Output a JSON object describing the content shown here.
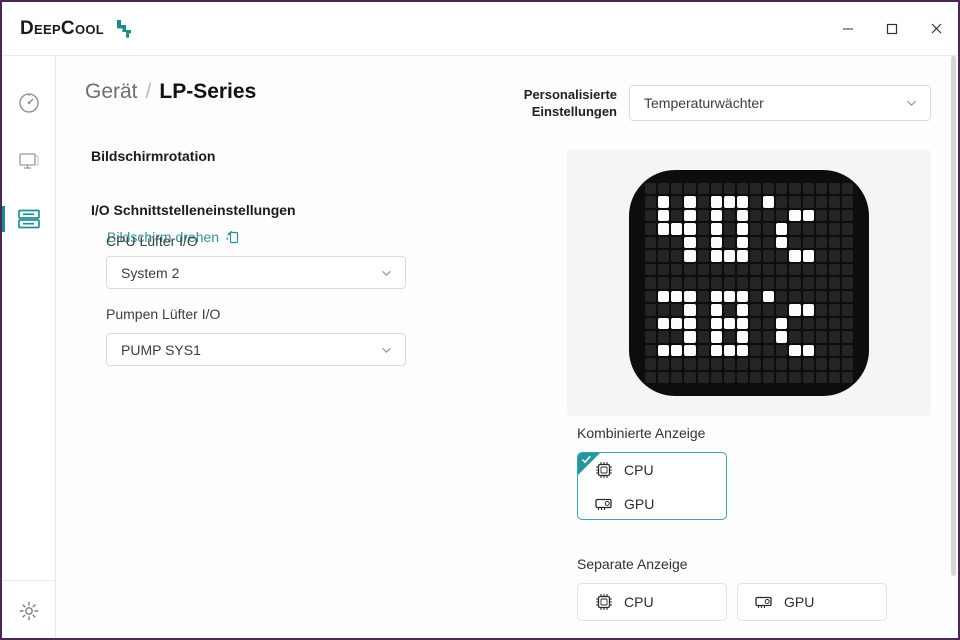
{
  "window": {
    "brand": "DeepCool",
    "brand_mark_icon": "deepcool-logo-icon",
    "controls": {
      "minimize": "minimize-icon",
      "maximize": "maximize-icon",
      "close": "close-icon"
    }
  },
  "sidebar": {
    "items": [
      {
        "icon": "gauge-icon",
        "name": "dashboard",
        "active": false
      },
      {
        "icon": "monitor-icon",
        "name": "monitor",
        "active": false
      },
      {
        "icon": "device-list-icon",
        "name": "device",
        "active": true
      }
    ],
    "bottom": {
      "icon": "gear-icon",
      "name": "settings"
    }
  },
  "breadcrumb": {
    "root": "Gerät",
    "separator": "/",
    "current": "LP-Series"
  },
  "preset": {
    "label": "Personalisierte\nEinstellungen",
    "value": "Temperaturwächter",
    "chevron_icon": "chevron-down-icon"
  },
  "rotation": {
    "section_title": "Bildschirmrotation",
    "link_label": "Bildschirm drehen",
    "link_icon": "rotate-screen-icon"
  },
  "io": {
    "section_title": "I/O Schnittstelleneinstellungen",
    "fields": [
      {
        "label": "CPU Lüfter I/O",
        "value": "System 2"
      },
      {
        "label": "Pumpen Lüfter I/O",
        "value": "PUMP SYS1"
      }
    ]
  },
  "display_preview": {
    "top_text": "40°C",
    "bottom_text": "38°C",
    "matrix_cols": 16,
    "matrix_rows": 15,
    "on_color": "#fdfdfd",
    "off_color": "#242424",
    "pixels": [
      [
        0,
        0,
        0,
        0,
        0,
        0,
        0,
        0,
        0,
        0,
        0,
        0,
        0,
        0,
        0,
        0
      ],
      [
        0,
        1,
        0,
        1,
        0,
        1,
        1,
        1,
        0,
        1,
        0,
        0,
        0,
        0,
        0,
        0
      ],
      [
        0,
        1,
        0,
        1,
        0,
        1,
        0,
        1,
        0,
        0,
        0,
        1,
        1,
        0,
        0,
        0
      ],
      [
        0,
        1,
        1,
        1,
        0,
        1,
        0,
        1,
        0,
        0,
        1,
        0,
        0,
        0,
        0,
        0
      ],
      [
        0,
        0,
        0,
        1,
        0,
        1,
        0,
        1,
        0,
        0,
        1,
        0,
        0,
        0,
        0,
        0
      ],
      [
        0,
        0,
        0,
        1,
        0,
        1,
        1,
        1,
        0,
        0,
        0,
        1,
        1,
        0,
        0,
        0
      ],
      [
        0,
        0,
        0,
        0,
        0,
        0,
        0,
        0,
        0,
        0,
        0,
        0,
        0,
        0,
        0,
        0
      ],
      [
        0,
        0,
        0,
        0,
        0,
        0,
        0,
        0,
        0,
        0,
        0,
        0,
        0,
        0,
        0,
        0
      ],
      [
        0,
        1,
        1,
        1,
        0,
        1,
        1,
        1,
        0,
        1,
        0,
        0,
        0,
        0,
        0,
        0
      ],
      [
        0,
        0,
        0,
        1,
        0,
        1,
        0,
        1,
        0,
        0,
        0,
        1,
        1,
        0,
        0,
        0
      ],
      [
        0,
        1,
        1,
        1,
        0,
        1,
        1,
        1,
        0,
        0,
        1,
        0,
        0,
        0,
        0,
        0
      ],
      [
        0,
        0,
        0,
        1,
        0,
        1,
        0,
        1,
        0,
        0,
        1,
        0,
        0,
        0,
        0,
        0
      ],
      [
        0,
        1,
        1,
        1,
        0,
        1,
        1,
        1,
        0,
        0,
        0,
        1,
        1,
        0,
        0,
        0
      ],
      [
        0,
        0,
        0,
        0,
        0,
        0,
        0,
        0,
        0,
        0,
        0,
        0,
        0,
        0,
        0,
        0
      ],
      [
        0,
        0,
        0,
        0,
        0,
        0,
        0,
        0,
        0,
        0,
        0,
        0,
        0,
        0,
        0,
        0
      ]
    ]
  },
  "combined": {
    "title": "Kombinierte Anzeige",
    "selected": true,
    "check_icon": "check-icon",
    "items": [
      {
        "label": "CPU",
        "icon": "cpu-chip-icon"
      },
      {
        "label": "GPU",
        "icon": "gpu-card-icon"
      }
    ]
  },
  "separate": {
    "title": "Separate Anzeige",
    "items": [
      {
        "label": "CPU",
        "icon": "cpu-chip-icon"
      },
      {
        "label": "GPU",
        "icon": "gpu-card-icon"
      }
    ]
  },
  "colors": {
    "accent": "#1a8a8f",
    "link": "#2e9196",
    "window_border": "#4a2a52",
    "panel_bg": "#f4f5f6"
  }
}
